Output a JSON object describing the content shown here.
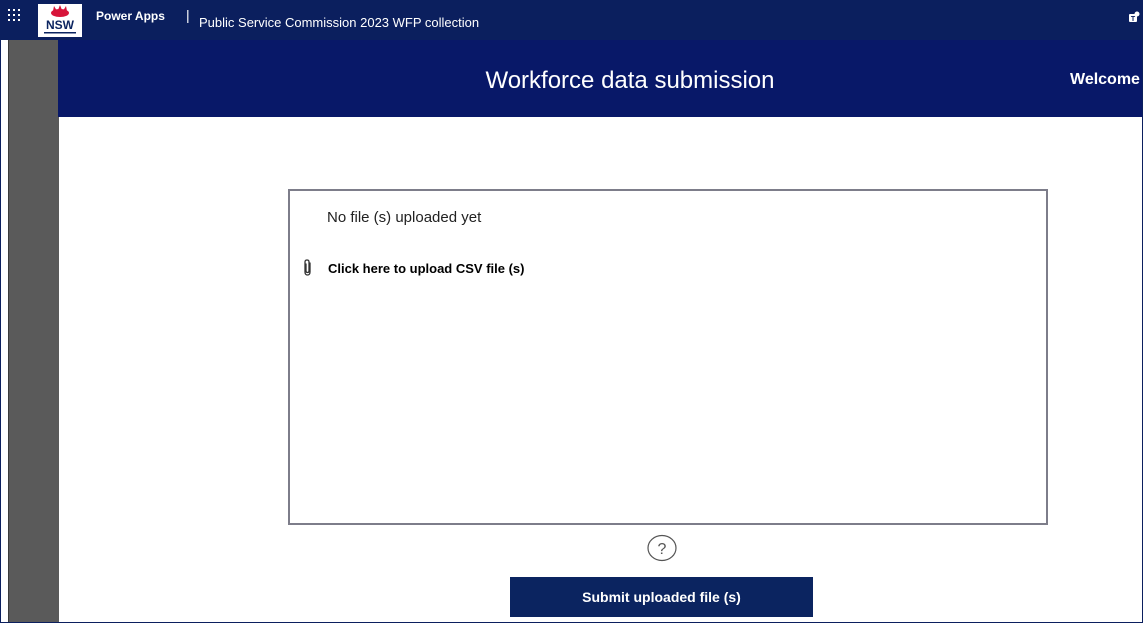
{
  "topbar": {
    "waffle_icon": "waffle-grid-icon",
    "logo_text": "NSW",
    "app_name": "Power Apps",
    "separator": "|",
    "app_title": "Public Service Commission 2023 WFP collection",
    "user_icon": "teams-user-icon"
  },
  "banner": {
    "title": "Workforce data submission",
    "welcome": "Welcome ,"
  },
  "upload": {
    "status_text": "No file (s) uploaded yet",
    "attach_icon": "paperclip-icon",
    "link_label": "Click here to upload CSV file (s)"
  },
  "help": {
    "icon": "question-circle-icon"
  },
  "submit": {
    "label": "Submit uploaded file (s)"
  },
  "colors": {
    "topbar": "#0b1f5e",
    "banner": "#081868",
    "rail": "#5a5a5a",
    "button": "#0b2460",
    "nsw_red": "#d7153a"
  }
}
